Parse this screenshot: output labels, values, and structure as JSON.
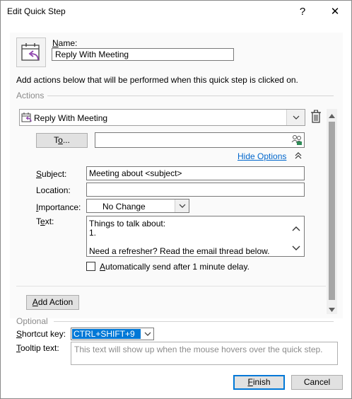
{
  "window": {
    "title": "Edit Quick Step",
    "help_glyph": "?",
    "close_glyph": "✕"
  },
  "quickstep": {
    "icon": "calendar-reply-icon",
    "name_label_mnemonic": "N",
    "name_label_rest": "ame:",
    "name_value": "Reply With Meeting"
  },
  "instructions": "Add actions below that will be performed when this quick step is clicked on.",
  "actions": {
    "section_label": "Actions",
    "action_value": "Reply With Meeting",
    "to_button": {
      "prefix": "T",
      "mnemonic": "o",
      "suffix": "..."
    },
    "to_value": "",
    "hide_options_mnemonic": "H",
    "hide_options_rest": "ide Options",
    "subject": {
      "label_mnemonic": "S",
      "label_rest": "ubject:",
      "value": "Meeting about <subject>"
    },
    "location": {
      "label": "Location:",
      "value": ""
    },
    "importance": {
      "label_mnemonic": "I",
      "label_rest": "mportance:",
      "value": "No Change"
    },
    "text": {
      "label_prefix": "T",
      "label_mnemonic": "e",
      "label_suffix": "xt:",
      "lines": [
        "Things to talk about:",
        "1.",
        "",
        "Need a refresher? Read the email thread below."
      ]
    },
    "auto_send": {
      "checked": false,
      "label_mnemonic": "A",
      "label_rest": "utomatically send after 1 minute delay."
    },
    "add_action": {
      "mnemonic": "A",
      "rest": "dd Action"
    }
  },
  "optional": {
    "section_label": "Optional",
    "shortcut": {
      "label_mnemonic": "S",
      "label_rest": "hortcut key:",
      "value": "CTRL+SHIFT+9"
    },
    "tooltip": {
      "label_mnemonic": "T",
      "label_rest": "ooltip text:",
      "placeholder": "This text will show up when the mouse hovers over the quick step."
    }
  },
  "footer": {
    "finish": {
      "mnemonic": "F",
      "rest": "inish"
    },
    "cancel": "Cancel"
  },
  "colors": {
    "accent": "#0078d7",
    "link": "#0066cc",
    "section_text": "#8a8a8a"
  }
}
